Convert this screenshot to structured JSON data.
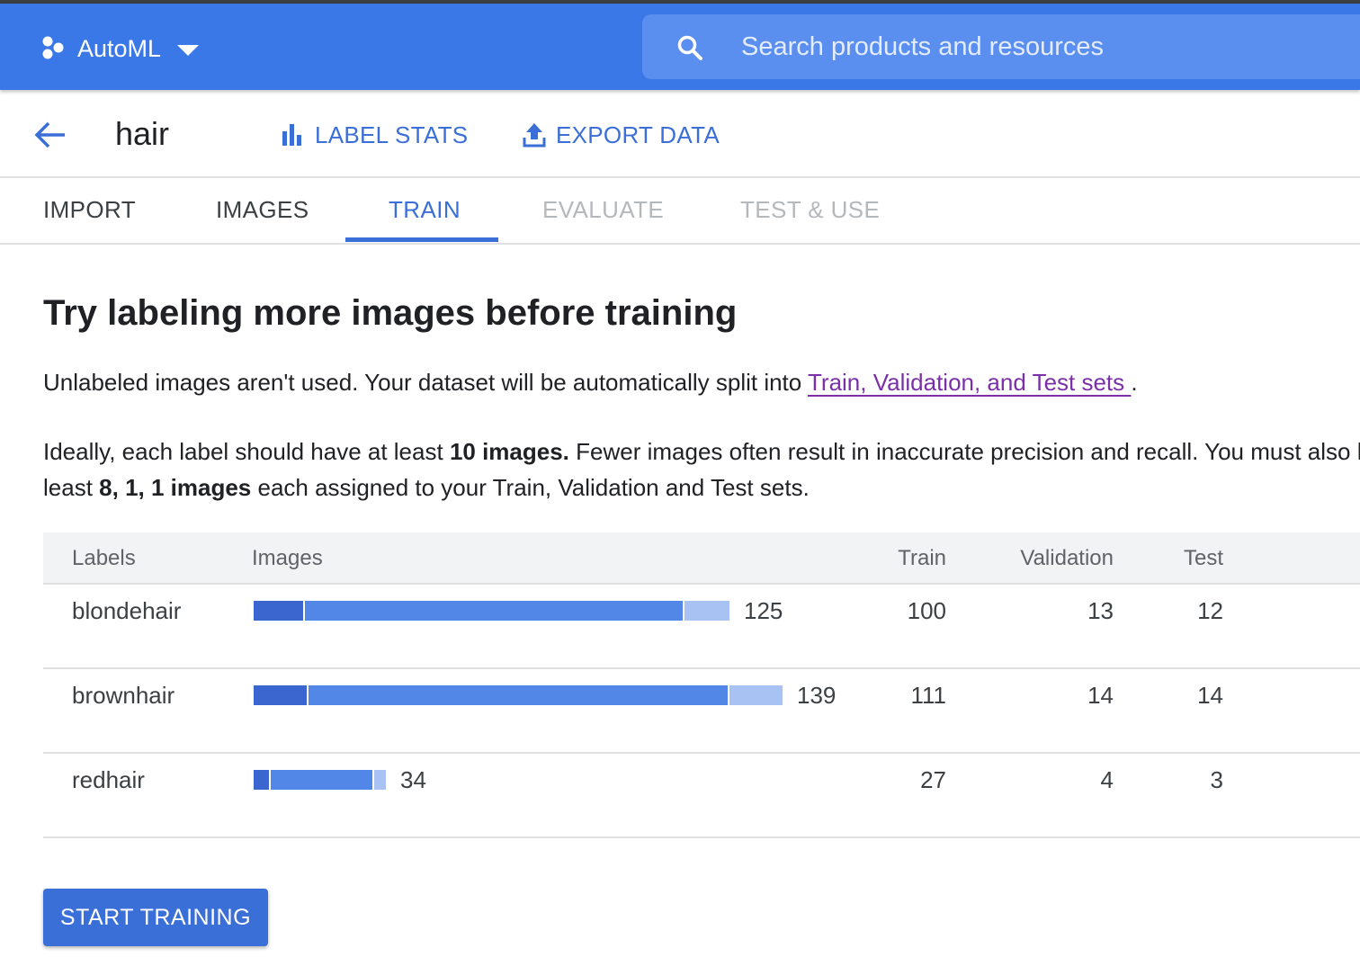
{
  "header": {
    "product_name": "AutoML",
    "product_icon": "automl-hexagon-icon",
    "search_placeholder": "Search products and resources"
  },
  "subheader": {
    "title": "hair",
    "actions": [
      {
        "label": "LABEL STATS",
        "icon": "bar-chart-icon"
      },
      {
        "label": "EXPORT DATA",
        "icon": "upload-icon"
      }
    ]
  },
  "tabs": [
    {
      "label": "IMPORT",
      "state": "enabled"
    },
    {
      "label": "IMAGES",
      "state": "enabled"
    },
    {
      "label": "TRAIN",
      "state": "active"
    },
    {
      "label": "EVALUATE",
      "state": "disabled"
    },
    {
      "label": "TEST & USE",
      "state": "disabled"
    }
  ],
  "content": {
    "heading": "Try labeling more images before training",
    "para1_text": "Unlabeled images aren't used. Your dataset will be automatically split into ",
    "para1_link": "Train, Validation, and Test sets ",
    "para1_end": ".",
    "para2_a": "Ideally, each label should have at least ",
    "para2_b": "10 images.",
    "para2_c": " Fewer images often result in inaccurate precision and recall. You must also have at",
    "para2_d": "least ",
    "para2_e": "8, 1, 1 images",
    "para2_f": " each assigned to your Train, Validation and Test sets."
  },
  "table": {
    "headers": {
      "labels": "Labels",
      "images": "Images",
      "train": "Train",
      "validation": "Validation",
      "test": "Test"
    },
    "rows": [
      {
        "label": "blondehair",
        "images": "125",
        "train": "100",
        "validation": "13",
        "test": "12"
      },
      {
        "label": "brownhair",
        "images": "139",
        "train": "111",
        "validation": "14",
        "test": "14"
      },
      {
        "label": "redhair",
        "images": "34",
        "train": "27",
        "validation": "4",
        "test": "3"
      }
    ]
  },
  "colors": {
    "appbar": "#3b78e7",
    "accent": "#3b6fd8",
    "bar_train": "#3b66cf",
    "bar_validation": "#5287e8",
    "bar_test": "#a8c3f3",
    "link": "#7b2fa8"
  },
  "footer": {
    "start_button": "START TRAINING"
  }
}
